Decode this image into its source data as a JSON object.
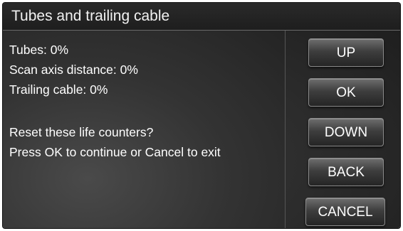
{
  "title": "Tubes and trailing cable",
  "counters": {
    "tubes": "Tubes: 0%",
    "scan_axis": "Scan axis distance: 0%",
    "trailing_cable": "Trailing cable: 0%"
  },
  "prompt": {
    "question": "Reset these life counters?",
    "instruction": "Press OK to continue or Cancel to exit"
  },
  "buttons": {
    "up": "UP",
    "ok": "OK",
    "down": "DOWN",
    "back": "BACK",
    "cancel": "CANCEL"
  }
}
